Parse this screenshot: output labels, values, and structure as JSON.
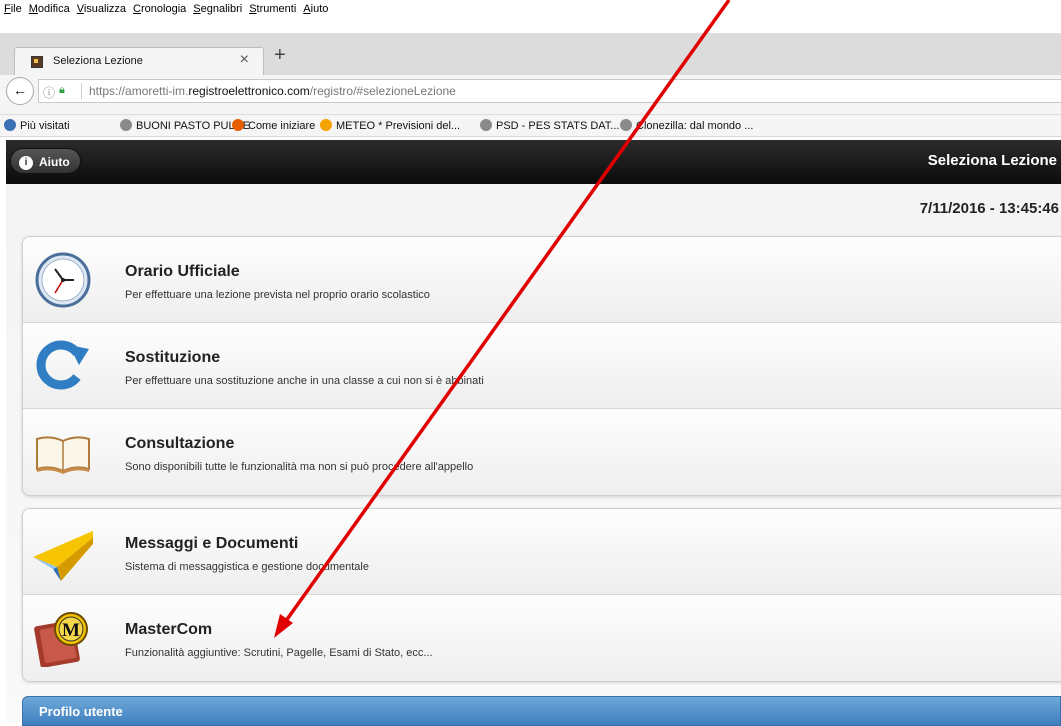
{
  "menu": [
    "File",
    "Modifica",
    "Visualizza",
    "Cronologia",
    "Segnalibri",
    "Strumenti",
    "Aiuto"
  ],
  "tab": {
    "title": "Seleziona Lezione",
    "close": "×",
    "new_tab": "+"
  },
  "address": {
    "url_prefix": "https://amoretti-im.",
    "url_domain": "registroelettronico.com",
    "url_suffix": "/registro/#selezioneLezione"
  },
  "bookmarks": [
    {
      "label": "Più visitati",
      "color": "#3b6fb6"
    },
    {
      "label": "BUONI PASTO PULCE",
      "color": "#8a8a8a"
    },
    {
      "label": "Come iniziare",
      "color": "#e66000"
    },
    {
      "label": "METEO * Previsioni del...",
      "color": "#f5a300"
    },
    {
      "label": "PSD - PES STATS DAT...",
      "color": "#8a8a8a"
    },
    {
      "label": "Clonezilla: dal mondo ...",
      "color": "#8a8a8a"
    }
  ],
  "header": {
    "help_label": "Aiuto",
    "help_icon": "i",
    "title": "Seleziona Lezione"
  },
  "datetime": "7/11/2016 - 13:45:46",
  "groups": [
    [
      {
        "icon": "clock-icon",
        "title": "Orario Ufficiale",
        "desc": "Per effettuare una lezione prevista nel proprio orario scolastico"
      },
      {
        "icon": "refresh-arrow-icon",
        "title": "Sostituzione",
        "desc": "Per effettuare una sostituzione anche in una classe a cui non si è abbinati"
      },
      {
        "icon": "open-book-icon",
        "title": "Consultazione",
        "desc": "Sono disponibili tutte le funzionalità ma non si può procedere all'appello"
      }
    ],
    [
      {
        "icon": "paper-plane-icon",
        "title": "Messaggi e Documenti",
        "desc": "Sistema di messaggistica e gestione documentale"
      },
      {
        "icon": "mastercom-logo-icon",
        "title": "MasterCom",
        "desc": "Funzionalità aggiuntive: Scrutini, Pagelle, Esami di Stato, ecc..."
      }
    ]
  ],
  "profile_section": "Profilo utente",
  "colors": {
    "header_bg": "#111111",
    "profile_bar": "#4a8ac6",
    "annotation_arrow": "#e00000"
  }
}
